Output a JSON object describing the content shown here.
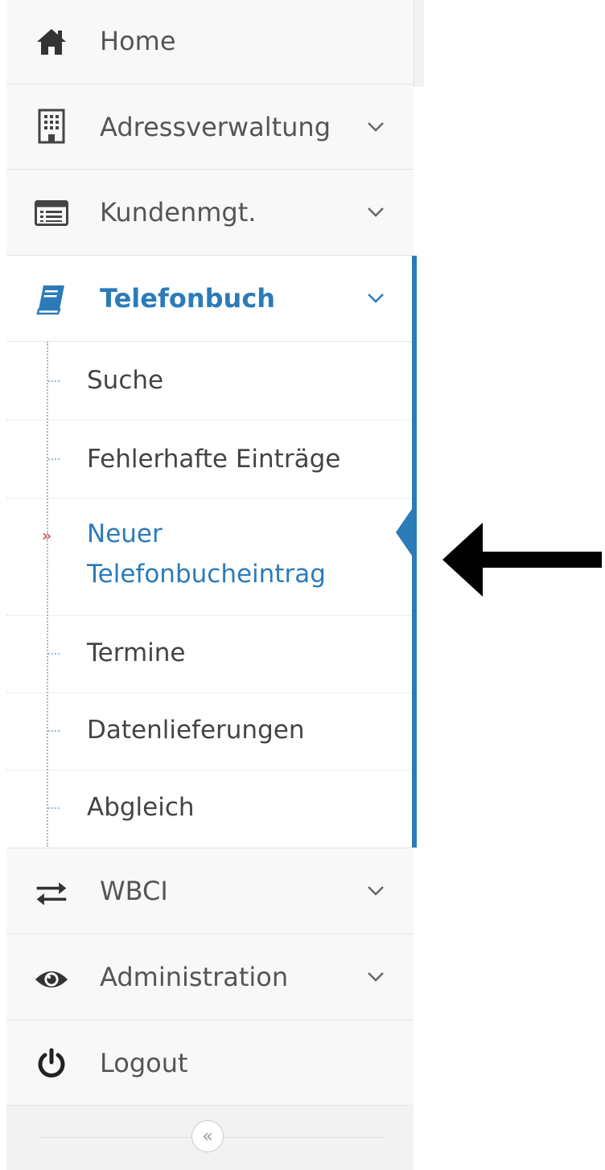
{
  "sidebar": {
    "items": [
      {
        "label": "Home",
        "icon": "home-icon"
      },
      {
        "label": "Adressverwaltung",
        "icon": "building-icon"
      },
      {
        "label": "Kundenmgt.",
        "icon": "list-card-icon"
      },
      {
        "label": "Telefonbuch",
        "icon": "book-icon"
      },
      {
        "label": "WBCI",
        "icon": "exchange-arrows-icon"
      },
      {
        "label": "Administration",
        "icon": "eye-icon"
      },
      {
        "label": "Logout",
        "icon": "power-icon"
      }
    ],
    "submenu": [
      {
        "label": "Suche"
      },
      {
        "label": "Fehlerhafte Einträge"
      },
      {
        "label_line1": "Neuer",
        "label_line2": "Telefonbucheintrag",
        "current": true
      },
      {
        "label": "Termine"
      },
      {
        "label": "Datenlieferungen"
      },
      {
        "label": "Abgleich"
      }
    ],
    "collapse_glyph": "«"
  },
  "colors": {
    "accent": "#2b7bb9",
    "text": "#555555",
    "current_marker": "#c0392b",
    "sidebar_bg": "#f8f8f8"
  }
}
